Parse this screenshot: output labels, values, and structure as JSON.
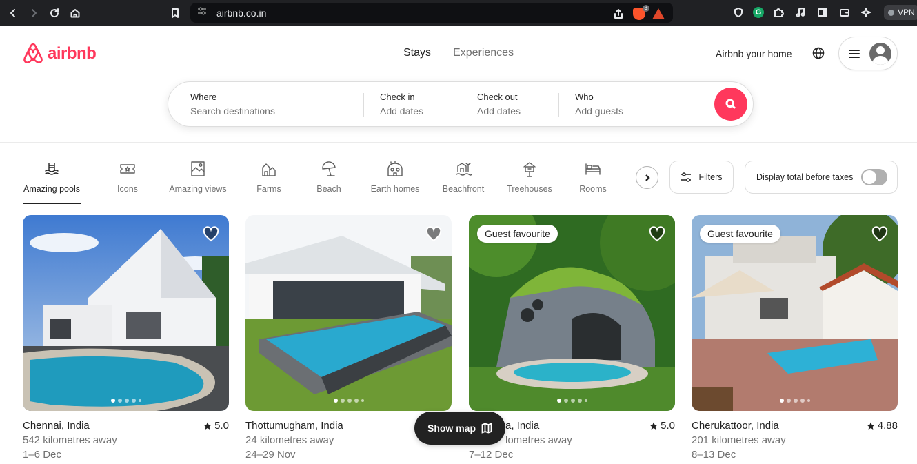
{
  "browser": {
    "url": "airbnb.co.in",
    "shield_count": "3",
    "vpn_label": "VPN"
  },
  "header": {
    "brand": "airbnb",
    "tabs": [
      {
        "label": "Stays"
      },
      {
        "label": "Experiences"
      }
    ],
    "host_link": "Airbnb your home"
  },
  "search": {
    "where": {
      "label": "Where",
      "placeholder": "Search destinations"
    },
    "checkin": {
      "label": "Check in",
      "placeholder": "Add dates"
    },
    "checkout": {
      "label": "Check out",
      "placeholder": "Add dates"
    },
    "who": {
      "label": "Who",
      "placeholder": "Add guests"
    }
  },
  "categories": [
    {
      "label": "Amazing pools",
      "icon": "pool-icon",
      "selected": true
    },
    {
      "label": "Icons",
      "icon": "ticket-icon"
    },
    {
      "label": "Amazing views",
      "icon": "view-icon"
    },
    {
      "label": "Farms",
      "icon": "barn-icon"
    },
    {
      "label": "Beach",
      "icon": "umbrella-icon"
    },
    {
      "label": "Earth homes",
      "icon": "earth-home-icon"
    },
    {
      "label": "Beachfront",
      "icon": "beachfront-icon"
    },
    {
      "label": "Treehouses",
      "icon": "treehouse-icon"
    },
    {
      "label": "Rooms",
      "icon": "bed-icon"
    }
  ],
  "filters_label": "Filters",
  "taxes_label": "Display total before taxes",
  "taxes_enabled": false,
  "listings": [
    {
      "location": "Chennai, India",
      "rating": "5.0",
      "distance": "542 kilometres away",
      "dates": "1–6 Dec",
      "badge": ""
    },
    {
      "location": "Thottumugham, India",
      "rating": "",
      "distance": "24 kilometres away",
      "dates": "24–29 Nov",
      "badge": ""
    },
    {
      "location": "a, India",
      "rating": "5.0",
      "distance": "lometres away",
      "dates": "7–12 Dec",
      "badge": "Guest favourite"
    },
    {
      "location": "Cherukattoor, India",
      "rating": "4.88",
      "distance": "201 kilometres away",
      "dates": "8–13 Dec",
      "badge": "Guest favourite"
    }
  ],
  "show_map_label": "Show map",
  "colors": {
    "brand": "#FF385C",
    "text": "#222222",
    "muted": "#717171"
  }
}
